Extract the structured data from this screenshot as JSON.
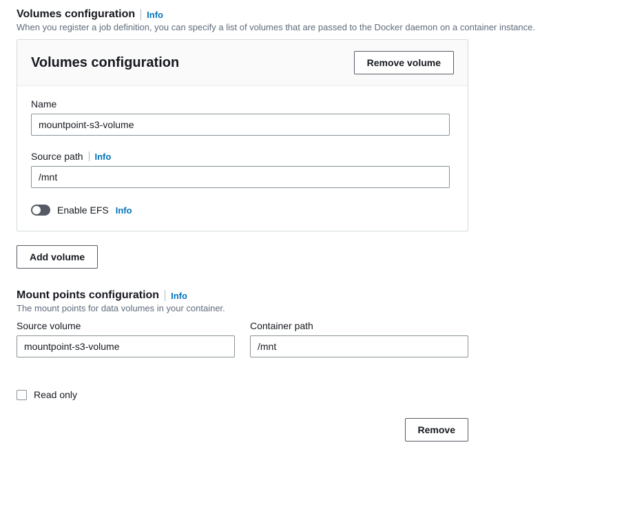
{
  "info_label": "Info",
  "volumes": {
    "heading": "Volumes configuration",
    "description": "When you register a job definition, you can specify a list of volumes that are passed to the Docker daemon on a container instance.",
    "panel_title": "Volumes configuration",
    "remove_button": "Remove volume",
    "name_label": "Name",
    "name_value": "mountpoint-s3-volume",
    "source_path_label": "Source path",
    "source_path_value": "/mnt",
    "enable_efs_label": "Enable EFS",
    "add_button": "Add volume"
  },
  "mount": {
    "heading": "Mount points configuration",
    "description": "The mount points for data volumes in your container.",
    "source_volume_label": "Source volume",
    "source_volume_value": "mountpoint-s3-volume",
    "container_path_label": "Container path",
    "container_path_value": "/mnt",
    "read_only_label": "Read only",
    "remove_button": "Remove"
  }
}
